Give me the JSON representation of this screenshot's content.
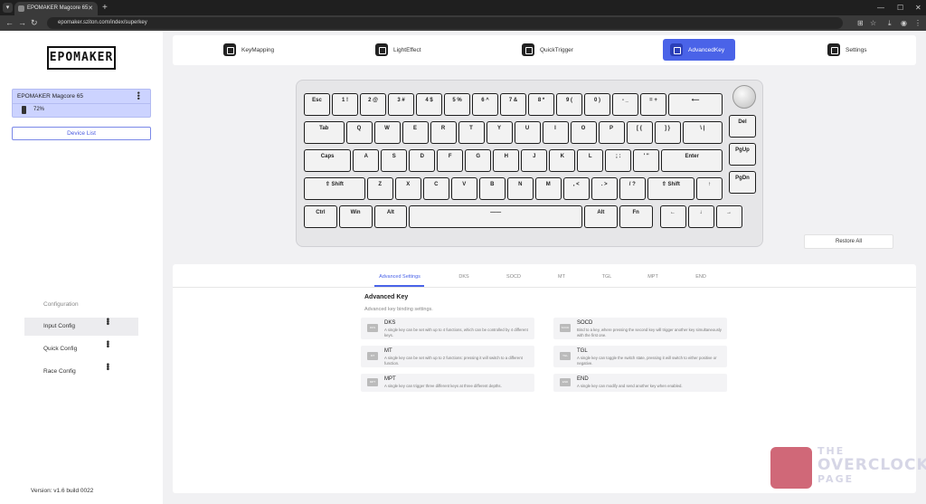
{
  "browser": {
    "tab_title": "EPOMAKER Magcore 65",
    "url": "epomaker.sziton.com/index/superkey"
  },
  "sidebar": {
    "logo": "EPOMAKER",
    "device_name": "EPOMAKER Magcore 65",
    "battery": "72%",
    "device_list_label": "Device List",
    "config_title": "Configuration",
    "configs": [
      "Input Config",
      "Quick Config",
      "Race Config"
    ],
    "version": "Version: v1.6 build 0022"
  },
  "topnav": {
    "tabs": [
      "KeyMapping",
      "LightEffect",
      "QuickTrigger",
      "AdvancedKey",
      "Settings"
    ],
    "active": "AdvancedKey"
  },
  "keyboard": {
    "rows": [
      [
        "Esc",
        "1 !",
        "2 @",
        "3 #",
        "4 $",
        "5 %",
        "6 ^",
        "7 &",
        "8 *",
        "9 (",
        "0 )",
        "- _",
        "= +",
        "⟵"
      ],
      [
        "Tab",
        "Q",
        "W",
        "E",
        "R",
        "T",
        "Y",
        "U",
        "I",
        "O",
        "P",
        "[ {",
        "] }",
        "\\ |"
      ],
      [
        "Caps",
        "A",
        "S",
        "D",
        "F",
        "G",
        "H",
        "J",
        "K",
        "L",
        "; :",
        "' \"",
        "Enter"
      ],
      [
        "⇧ Shift",
        "Z",
        "X",
        "C",
        "V",
        "B",
        "N",
        "M",
        ", <",
        ". >",
        "/ ?",
        "⇧ Shift",
        "↑"
      ],
      [
        "Ctrl",
        "Win",
        "Alt",
        "——",
        "Alt",
        "Fn",
        "←",
        "↓",
        "→"
      ]
    ],
    "right_column": [
      "Del",
      "PgUp",
      "PgDn"
    ],
    "restore_label": "Restore All"
  },
  "panel": {
    "subtabs": [
      "Advanced Settings",
      "DKS",
      "SOCD",
      "MT",
      "TGL",
      "MPT",
      "END"
    ],
    "active_subtab": "Advanced Settings",
    "title": "Advanced Key",
    "subtitle": "Advanced key binding settings.",
    "cards": [
      {
        "name": "DKS",
        "icon": "dks-icon",
        "desc": "A single key can be set with up to 4 functions, which can be controlled by 4 different keys."
      },
      {
        "name": "SOCD",
        "icon": "socd-icon",
        "desc": "Bind to a key, where pressing the second key will trigger another key simultaneously with the first one."
      },
      {
        "name": "MT",
        "icon": "mt-icon",
        "desc": "A single key can be set with up to 2 functions: pressing it will switch to a different function."
      },
      {
        "name": "TGL",
        "icon": "tgl-icon",
        "desc": "A single key can toggle the switch state, pressing it will switch to either positive or negative."
      },
      {
        "name": "MPT",
        "icon": "mpt-icon",
        "desc": "A single key can trigger three different keys at three different depths."
      },
      {
        "name": "END",
        "icon": "end-icon",
        "desc": "A single key can modify and send another key when enabled."
      }
    ]
  },
  "watermark": {
    "line1": "THE",
    "line2": "OVERCLOCK",
    "line3": "PAGE"
  }
}
